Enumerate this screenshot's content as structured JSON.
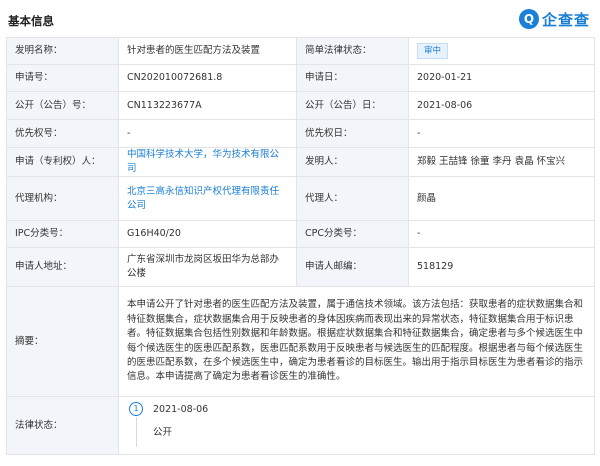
{
  "section_title": "基本信息",
  "brand": {
    "logo_char": "Q",
    "name": "企查查",
    "logo_color": "#1a7fd6"
  },
  "fields": {
    "invention_name": {
      "label": "发明名称：",
      "value": "针对患者的医生匹配方法及装置"
    },
    "legal_status": {
      "label": "简单法律状态：",
      "value": "审中"
    },
    "app_no": {
      "label": "申请号：",
      "value": "CN202010072681.8"
    },
    "app_date": {
      "label": "申请日：",
      "value": "2020-01-21"
    },
    "pub_no": {
      "label": "公开（公告）号：",
      "value": "CN113223677A"
    },
    "pub_date": {
      "label": "公开（公告）日：",
      "value": "2021-08-06"
    },
    "priority_no": {
      "label": "优先权号：",
      "value": "-"
    },
    "priority_date": {
      "label": "优先权日：",
      "value": "-"
    },
    "applicant": {
      "label": "申请（专利权）人：",
      "value1": "中国科学技术大学",
      "sep": "，",
      "value2": "华为技术有限公司"
    },
    "inventor": {
      "label": "发明人：",
      "value": "郑毅 王喆锋 徐童 李丹 袁晶 怀宝兴"
    },
    "agency": {
      "label": "代理机构：",
      "value": "北京三高永信知识产权代理有限责任公司"
    },
    "agent": {
      "label": "代理人：",
      "value": "颜晶"
    },
    "ipc": {
      "label": "IPC分类号：",
      "value": "G16H40/20"
    },
    "cpc": {
      "label": "CPC分类号：",
      "value": "-"
    },
    "address": {
      "label": "申请人地址：",
      "value": "广东省深圳市龙岗区坂田华为总部办公楼"
    },
    "postcode": {
      "label": "申请人邮编：",
      "value": "518129"
    },
    "abstract": {
      "label": "摘要：",
      "value": "本申请公开了针对患者的医生匹配方法及装置，属于通信技术领域。该方法包括：获取患者的症状数据集合和特征数据集合，症状数据集合用于反映患者的身体因疾病而表现出来的异常状态，特征数据集合用于标识患者。特征数据集合包括性别数据和年龄数据。根据症状数据集合和特征数据集合，确定患者与多个候选医生中每个候选医生的医患匹配系数，医患匹配系数用于反映患者与候选医生的匹配程度。根据患者与每个候选医生的医患匹配系数，在多个候选医生中，确定为患者看诊的目标医生。输出用于指示目标医生为患者看诊的指示信息。本申请提高了确定为患者看诊医生的准确性。"
    },
    "law_status": {
      "label": "法律状态：",
      "timeline": [
        {
          "index": "1",
          "date": "2021-08-06",
          "status": "公开"
        }
      ]
    }
  }
}
